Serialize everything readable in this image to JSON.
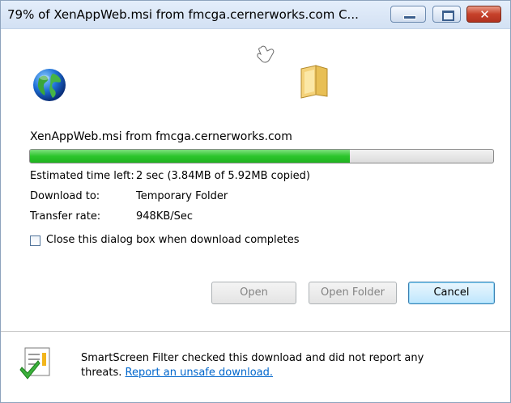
{
  "window": {
    "title": "79% of XenAppWeb.msi from fmcga.cernerworks.com C...",
    "close_glyph": "✕"
  },
  "download": {
    "filename_line": "XenAppWeb.msi from fmcga.cernerworks.com",
    "progress": 0.69
  },
  "info": {
    "estimated_label": "Estimated time left:",
    "estimated_value": "2 sec (3.84MB of 5.92MB copied)",
    "download_to_label": "Download to:",
    "download_to_value": "Temporary Folder",
    "rate_label": "Transfer rate:",
    "rate_value": "948KB/Sec"
  },
  "close_when_done": {
    "label": "Close this dialog box when download completes",
    "checked": false
  },
  "buttons": {
    "open": "Open",
    "open_folder": "Open Folder",
    "cancel": "Cancel"
  },
  "smartscreen": {
    "text": "SmartScreen Filter checked this download and did not report any threats.",
    "link": "Report an unsafe download."
  },
  "icons": {
    "globe": "globe-icon",
    "hand": "hand-pointer-icon",
    "folder": "folder-icon",
    "shield": "smartscreen-check-icon"
  },
  "colors": {
    "progress_fill": "#2dc52d",
    "link": "#0066cc",
    "close_button": "#c6412a"
  }
}
